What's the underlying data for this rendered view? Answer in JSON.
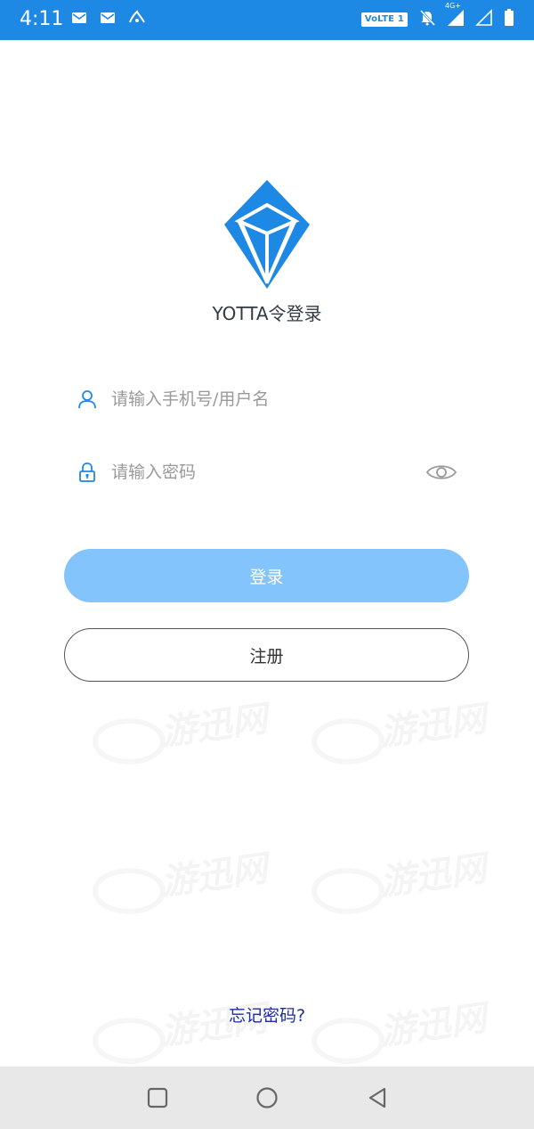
{
  "status_bar": {
    "time": "4:11",
    "volte": "VoLTE 1",
    "network": "4G+",
    "icons": [
      "gmail-icon",
      "gmail-icon",
      "app-notification-icon",
      "bell-off-icon",
      "signal-icon",
      "signal-empty-icon",
      "battery-icon"
    ]
  },
  "app": {
    "title": "YOTTA令登录"
  },
  "login_form": {
    "username_placeholder": "请输入手机号/用户名",
    "username_value": "",
    "password_placeholder": "请输入密码",
    "password_value": "",
    "login_label": "登录",
    "register_label": "注册",
    "forgot_label": "忘记密码?"
  },
  "watermark": {
    "text": "游迅网"
  },
  "colors": {
    "status_bar": "#1e88e5",
    "login_button": "#82c4fb",
    "icon_blue": "#1e88e5",
    "forgot_link": "#1d2d9d",
    "nav_bar": "#e8e8e8"
  },
  "nav_bar": {
    "buttons": [
      "recents-square-icon",
      "home-circle-icon",
      "back-triangle-icon"
    ]
  }
}
